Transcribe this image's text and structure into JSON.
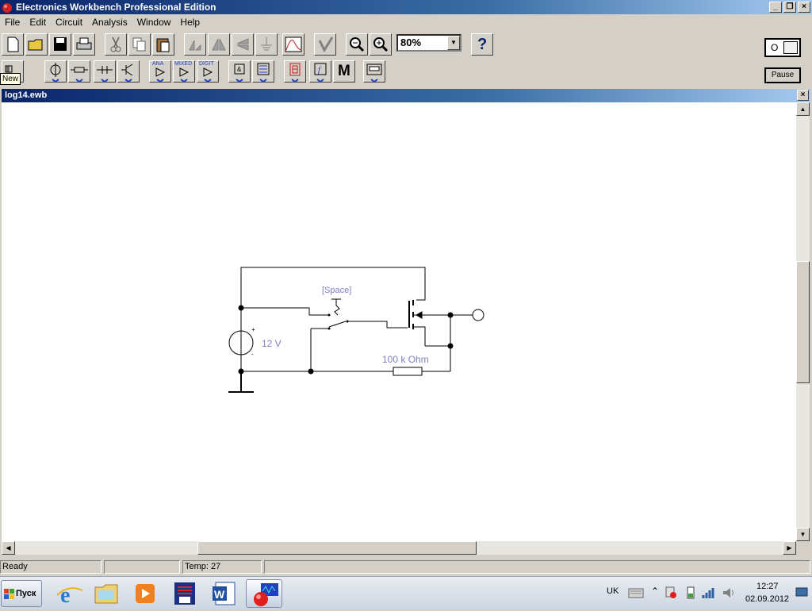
{
  "window": {
    "title": "Electronics Workbench Professional Edition",
    "controls": [
      "_",
      "❐",
      "×"
    ]
  },
  "menu": [
    "File",
    "Edit",
    "Circuit",
    "Analysis",
    "Window",
    "Help"
  ],
  "toolbar": {
    "zoom_value": "80%",
    "help_label": "?",
    "pause_label": "Pause",
    "switch_label": "O"
  },
  "parts_bin": {
    "labels": [
      "ANA",
      "MIXED",
      "DIGIT"
    ],
    "meter_label": "M"
  },
  "tooltip": "New",
  "document": {
    "title": "log14.ewb",
    "close": "×"
  },
  "circuit": {
    "source_label": "12 V",
    "resistor_label": "100 k Ohm",
    "switch_key": "[Space]",
    "plus": "+",
    "minus": "-"
  },
  "status": {
    "state": "Ready",
    "panel2": "",
    "temp": "Temp:  27",
    "panel4": ""
  },
  "taskbar": {
    "start_label": "Пуск",
    "language": "UK",
    "time": "12:27",
    "date": "02.09.2012"
  },
  "colors": {
    "title_gradient_start": "#0a246a",
    "title_gradient_end": "#a6caf0",
    "label_color": "#8080c0"
  }
}
